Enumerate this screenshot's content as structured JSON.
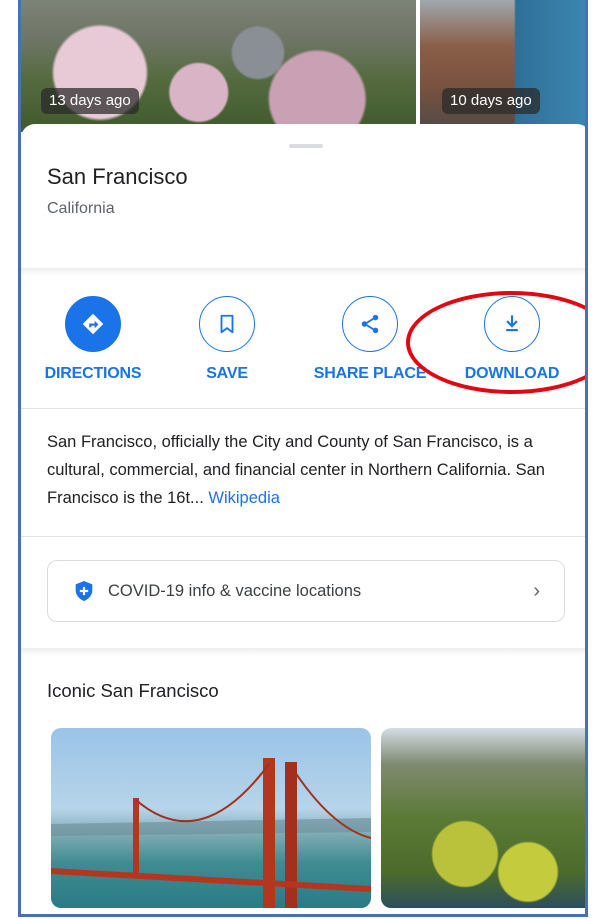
{
  "photos": [
    {
      "age": "13 days ago"
    },
    {
      "age": "10 days ago"
    }
  ],
  "place": {
    "title": "San Francisco",
    "subtitle": "California"
  },
  "actions": [
    {
      "label": "DIRECTIONS",
      "icon": "directions-icon"
    },
    {
      "label": "SAVE",
      "icon": "bookmark-icon"
    },
    {
      "label": "SHARE PLACE",
      "icon": "share-icon"
    },
    {
      "label": "DOWNLOAD",
      "icon": "download-icon"
    }
  ],
  "description": {
    "text": "San Francisco, officially the City and County of San Francisco, is a cultural, commercial, and financial center in Northern California. San Francisco is the 16t... ",
    "source_link": "Wikipedia"
  },
  "covid": {
    "label": "COVID-19 info & vaccine locations",
    "icon": "shield-plus-icon",
    "chevron": "›"
  },
  "section": {
    "title": "Iconic San Francisco"
  },
  "colors": {
    "accent": "#1a73e8",
    "highlight_ring": "#e30613",
    "frame_border": "#4a6fb5"
  }
}
